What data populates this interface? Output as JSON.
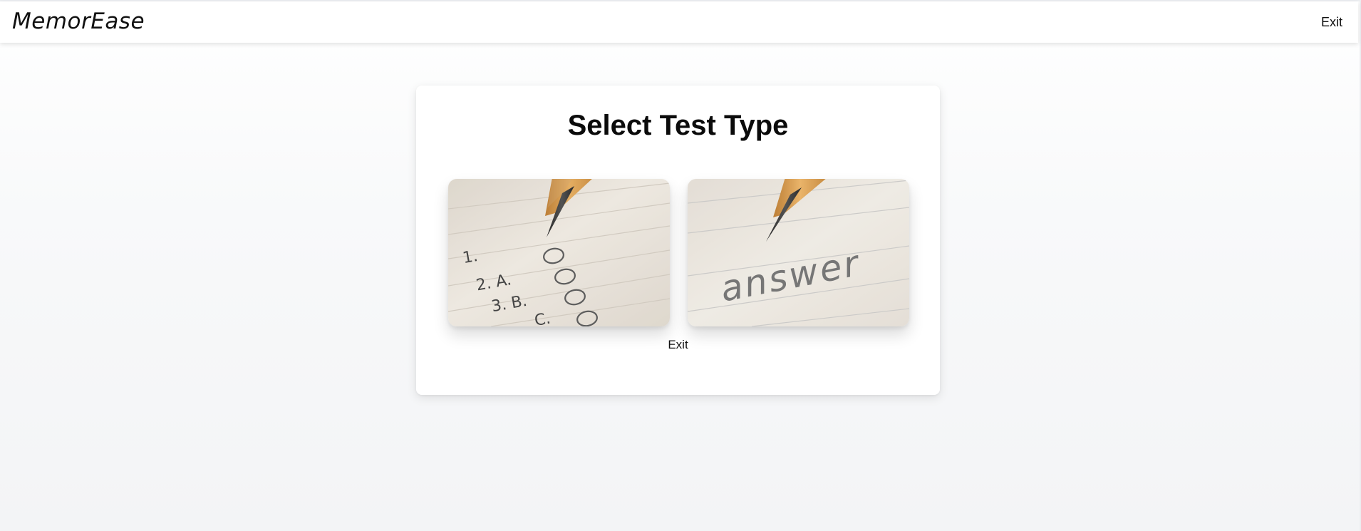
{
  "header": {
    "logo_text": "MemorEase",
    "exit_label": "Exit"
  },
  "card": {
    "title": "Select Test Type",
    "options": [
      {
        "name": "multiple-choice-test",
        "image_text": {
          "line1": "1.",
          "line2": "2.  A.",
          "line3": "3.  B.",
          "line4": "C."
        }
      },
      {
        "name": "written-answer-test",
        "image_text": {
          "word": "answer"
        }
      }
    ],
    "exit_label": "Exit"
  },
  "colors": {
    "paper": "#e8e2d8",
    "pencil_wood": "#d9a15a",
    "graphite": "#2a2a2a",
    "background": "#f5f6f8",
    "text": "#111111"
  },
  "icons": {
    "mc_image": "pencil-on-multiple-choice-sheet",
    "written_image": "pencil-writing-answer"
  }
}
